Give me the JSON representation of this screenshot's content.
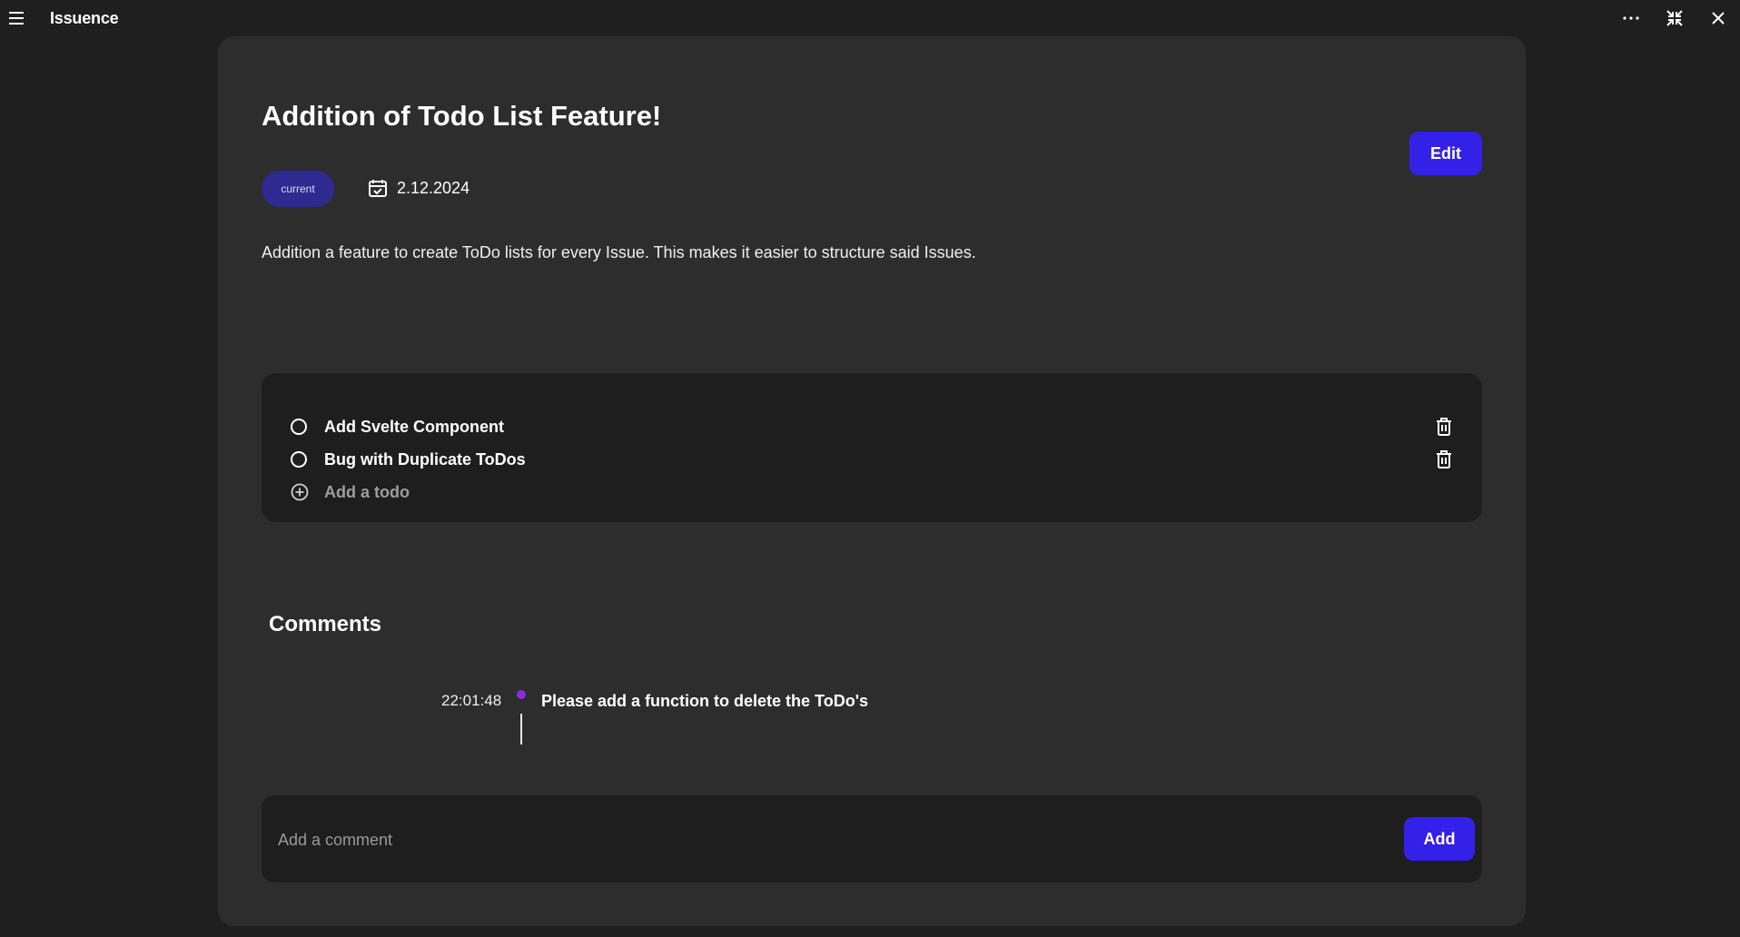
{
  "app": {
    "title": "Issuence"
  },
  "window_controls": {
    "more_icon": "more-horizontal-icon",
    "restore_icon": "minimize-window-icon",
    "close_icon": "close-icon"
  },
  "issue": {
    "title": "Addition of Todo List Feature!",
    "edit_label": "Edit",
    "status": "current",
    "date": "2.12.2024",
    "description": "Addition a feature to create ToDo lists for every Issue. This makes it easier to structure said Issues."
  },
  "todos": {
    "items": [
      {
        "label": "Add Svelte Component",
        "done": false
      },
      {
        "label": "Bug with Duplicate ToDos",
        "done": false
      }
    ],
    "add_label": "Add a todo"
  },
  "comments": {
    "heading": "Comments",
    "items": [
      {
        "time": "22:01:48",
        "text": "Please add a function to delete the ToDo's"
      }
    ],
    "input_placeholder": "Add a comment",
    "add_label": "Add"
  },
  "colors": {
    "background": "#1f1f1f",
    "card": "#2d2d2d",
    "panel": "#1e1e1e",
    "accent": "#3421e8",
    "badge": "#2f2a8f",
    "timeline_dot": "#8a2be2"
  }
}
